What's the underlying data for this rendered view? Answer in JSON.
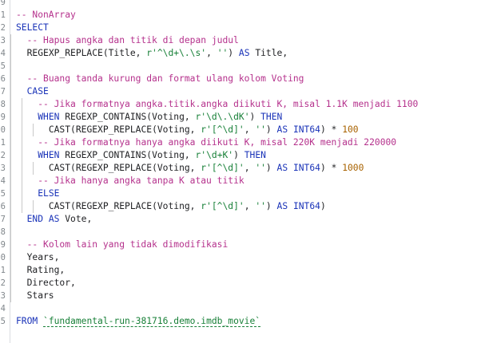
{
  "editor": {
    "line_numbers": [
      "9",
      "1",
      "2",
      "3",
      "4",
      "5",
      "6",
      "7",
      "8",
      "9",
      "0",
      "1",
      "2",
      "3",
      "4",
      "5",
      "6",
      "7",
      "8",
      "9",
      "0",
      "1",
      "2",
      "3",
      "4",
      "5"
    ],
    "lines": [
      {
        "guides": [],
        "tokens": []
      },
      {
        "guides": [],
        "tokens": [
          {
            "c": "c",
            "t": "-- NonArray"
          }
        ]
      },
      {
        "guides": [],
        "tokens": [
          {
            "c": "k",
            "t": "SELECT"
          }
        ]
      },
      {
        "guides": [
          13
        ],
        "tokens": [
          {
            "c": "p",
            "t": "  "
          },
          {
            "c": "c",
            "t": "-- Hapus angka dan titik di depan judul"
          }
        ]
      },
      {
        "guides": [
          13
        ],
        "tokens": [
          {
            "c": "p",
            "t": "  "
          },
          {
            "c": "f",
            "t": "REGEXP_REPLACE"
          },
          {
            "c": "p",
            "t": "(Title, "
          },
          {
            "c": "s",
            "t": "r'^\\d+\\.\\s'"
          },
          {
            "c": "p",
            "t": ", "
          },
          {
            "c": "s",
            "t": "''"
          },
          {
            "c": "p",
            "t": ") "
          },
          {
            "c": "k",
            "t": "AS"
          },
          {
            "c": "p",
            "t": " Title,"
          }
        ]
      },
      {
        "guides": [
          13
        ],
        "tokens": []
      },
      {
        "guides": [
          13
        ],
        "tokens": [
          {
            "c": "p",
            "t": "  "
          },
          {
            "c": "c",
            "t": "-- Buang tanda kurung dan format ulang kolom Voting"
          }
        ]
      },
      {
        "guides": [
          13
        ],
        "tokens": [
          {
            "c": "p",
            "t": "  "
          },
          {
            "c": "k",
            "t": "CASE"
          }
        ]
      },
      {
        "guides": [
          13,
          27
        ],
        "tokens": [
          {
            "c": "p",
            "t": "    "
          },
          {
            "c": "c",
            "t": "-- Jika formatnya angka.titik.angka diikuti K, misal 1.1K menjadi 1100"
          }
        ]
      },
      {
        "guides": [
          13,
          27
        ],
        "tokens": [
          {
            "c": "p",
            "t": "    "
          },
          {
            "c": "k",
            "t": "WHEN"
          },
          {
            "c": "p",
            "t": " "
          },
          {
            "c": "f",
            "t": "REGEXP_CONTAINS"
          },
          {
            "c": "p",
            "t": "(Voting, "
          },
          {
            "c": "s",
            "t": "r'\\d\\.\\dK'"
          },
          {
            "c": "p",
            "t": ") "
          },
          {
            "c": "k",
            "t": "THEN"
          }
        ]
      },
      {
        "guides": [
          13,
          27,
          41
        ],
        "tokens": [
          {
            "c": "p",
            "t": "      "
          },
          {
            "c": "f",
            "t": "CAST"
          },
          {
            "c": "p",
            "t": "("
          },
          {
            "c": "f",
            "t": "REGEXP_REPLACE"
          },
          {
            "c": "p",
            "t": "(Voting, "
          },
          {
            "c": "s",
            "t": "r'[^\\d]'"
          },
          {
            "c": "p",
            "t": ", "
          },
          {
            "c": "s",
            "t": "''"
          },
          {
            "c": "p",
            "t": ") "
          },
          {
            "c": "k",
            "t": "AS"
          },
          {
            "c": "p",
            "t": " "
          },
          {
            "c": "k",
            "t": "INT64"
          },
          {
            "c": "p",
            "t": ") * "
          },
          {
            "c": "n",
            "t": "100"
          }
        ]
      },
      {
        "guides": [
          13,
          27
        ],
        "tokens": [
          {
            "c": "p",
            "t": "    "
          },
          {
            "c": "c",
            "t": "-- Jika formatnya hanya angka diikuti K, misal 220K menjadi 220000"
          }
        ]
      },
      {
        "guides": [
          13,
          27
        ],
        "tokens": [
          {
            "c": "p",
            "t": "    "
          },
          {
            "c": "k",
            "t": "WHEN"
          },
          {
            "c": "p",
            "t": " "
          },
          {
            "c": "f",
            "t": "REGEXP_CONTAINS"
          },
          {
            "c": "p",
            "t": "(Voting, "
          },
          {
            "c": "s",
            "t": "r'\\d+K'"
          },
          {
            "c": "p",
            "t": ") "
          },
          {
            "c": "k",
            "t": "THEN"
          }
        ]
      },
      {
        "guides": [
          13,
          27,
          41
        ],
        "tokens": [
          {
            "c": "p",
            "t": "      "
          },
          {
            "c": "f",
            "t": "CAST"
          },
          {
            "c": "p",
            "t": "("
          },
          {
            "c": "f",
            "t": "REGEXP_REPLACE"
          },
          {
            "c": "p",
            "t": "(Voting, "
          },
          {
            "c": "s",
            "t": "r'[^\\d]'"
          },
          {
            "c": "p",
            "t": ", "
          },
          {
            "c": "s",
            "t": "''"
          },
          {
            "c": "p",
            "t": ") "
          },
          {
            "c": "k",
            "t": "AS"
          },
          {
            "c": "p",
            "t": " "
          },
          {
            "c": "k",
            "t": "INT64"
          },
          {
            "c": "p",
            "t": ") * "
          },
          {
            "c": "n",
            "t": "1000"
          }
        ]
      },
      {
        "guides": [
          13,
          27
        ],
        "tokens": [
          {
            "c": "p",
            "t": "    "
          },
          {
            "c": "c",
            "t": "-- Jika hanya angka tanpa K atau titik"
          }
        ]
      },
      {
        "guides": [
          13,
          27
        ],
        "tokens": [
          {
            "c": "p",
            "t": "    "
          },
          {
            "c": "k",
            "t": "ELSE"
          }
        ]
      },
      {
        "guides": [
          13,
          27,
          41
        ],
        "tokens": [
          {
            "c": "p",
            "t": "      "
          },
          {
            "c": "f",
            "t": "CAST"
          },
          {
            "c": "p",
            "t": "("
          },
          {
            "c": "f",
            "t": "REGEXP_REPLACE"
          },
          {
            "c": "p",
            "t": "(Voting, "
          },
          {
            "c": "s",
            "t": "r'[^\\d]'"
          },
          {
            "c": "p",
            "t": ", "
          },
          {
            "c": "s",
            "t": "''"
          },
          {
            "c": "p",
            "t": ") "
          },
          {
            "c": "k",
            "t": "AS"
          },
          {
            "c": "p",
            "t": " "
          },
          {
            "c": "k",
            "t": "INT64"
          },
          {
            "c": "p",
            "t": ")"
          }
        ]
      },
      {
        "guides": [
          13
        ],
        "tokens": [
          {
            "c": "p",
            "t": "  "
          },
          {
            "c": "k",
            "t": "END"
          },
          {
            "c": "p",
            "t": " "
          },
          {
            "c": "k",
            "t": "AS"
          },
          {
            "c": "p",
            "t": " Vote,"
          }
        ]
      },
      {
        "guides": [
          13
        ],
        "tokens": []
      },
      {
        "guides": [
          13
        ],
        "tokens": [
          {
            "c": "p",
            "t": "  "
          },
          {
            "c": "c",
            "t": "-- Kolom lain yang tidak dimodifikasi"
          }
        ]
      },
      {
        "guides": [
          13
        ],
        "tokens": [
          {
            "c": "p",
            "t": "  Years,"
          }
        ]
      },
      {
        "guides": [
          13
        ],
        "tokens": [
          {
            "c": "p",
            "t": "  Rating,"
          }
        ]
      },
      {
        "guides": [
          13
        ],
        "tokens": [
          {
            "c": "p",
            "t": "  Director,"
          }
        ]
      },
      {
        "guides": [
          13
        ],
        "tokens": [
          {
            "c": "p",
            "t": "  Stars"
          }
        ]
      },
      {
        "guides": [],
        "tokens": []
      },
      {
        "guides": [],
        "tokens": [
          {
            "c": "k",
            "t": "FROM"
          },
          {
            "c": "p",
            "t": " "
          },
          {
            "c": "tbl",
            "t": "`fundamental-run-381716.demo.imdb_movie`"
          }
        ]
      }
    ]
  }
}
